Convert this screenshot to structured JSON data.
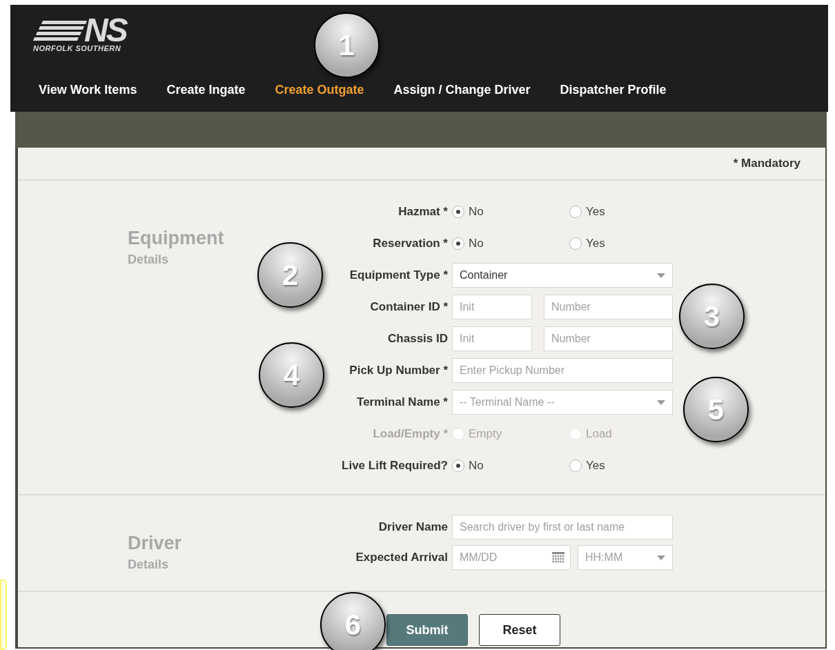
{
  "logo": {
    "mark": "NS",
    "name": "NORFOLK SOUTHERN"
  },
  "nav": [
    {
      "label": "View Work Items",
      "selected": false
    },
    {
      "label": "Create Ingate",
      "selected": false
    },
    {
      "label": "Create Outgate",
      "selected": true
    },
    {
      "label": "Assign / Change Driver",
      "selected": false
    },
    {
      "label": "Dispatcher Profile",
      "selected": false
    }
  ],
  "mandatory_note": "* Mandatory",
  "sections": [
    {
      "title": "Equipment",
      "subtitle": "Details",
      "rows": [
        {
          "kind": "radio",
          "label": "Hazmat *",
          "disabled": false,
          "options": [
            {
              "label": "No",
              "selected": true
            },
            {
              "label": "Yes",
              "selected": false
            }
          ]
        },
        {
          "kind": "radio",
          "label": "Reservation *",
          "disabled": false,
          "options": [
            {
              "label": "No",
              "selected": true
            },
            {
              "label": "Yes",
              "selected": false
            }
          ]
        },
        {
          "kind": "select",
          "label": "Equipment Type *",
          "value": "Container"
        },
        {
          "kind": "pair",
          "label": "Container ID *",
          "fields": [
            {
              "placeholder": "Init"
            },
            {
              "placeholder": "Number"
            }
          ]
        },
        {
          "kind": "pair",
          "label": "Chassis ID",
          "fields": [
            {
              "placeholder": "Init"
            },
            {
              "placeholder": "Number"
            }
          ]
        },
        {
          "kind": "text",
          "label": "Pick Up Number *",
          "placeholder": "Enter Pickup Number"
        },
        {
          "kind": "select",
          "label": "Terminal Name *",
          "placeholder": "-- Terminal Name --"
        },
        {
          "kind": "radio",
          "label": "Load/Empty *",
          "disabled": true,
          "options": [
            {
              "label": "Empty",
              "selected": false
            },
            {
              "label": "Load",
              "selected": false
            }
          ]
        },
        {
          "kind": "radio",
          "label": "Live Lift Required?",
          "disabled": false,
          "options": [
            {
              "label": "No",
              "selected": true
            },
            {
              "label": "Yes",
              "selected": false
            }
          ]
        }
      ]
    },
    {
      "title": "Driver",
      "subtitle": "Details",
      "rows": [
        {
          "kind": "text",
          "label": "Driver Name",
          "placeholder": "Search driver by first or last name"
        },
        {
          "kind": "datetime",
          "label": "Expected Arrival",
          "date_placeholder": "MM/DD",
          "time_placeholder": "HH:MM"
        }
      ]
    }
  ],
  "buttons": [
    {
      "label": "Submit",
      "kind": "primary"
    },
    {
      "label": "Reset",
      "kind": "secondary"
    }
  ],
  "callouts": [
    {
      "label": "1"
    },
    {
      "label": "2"
    },
    {
      "label": "3"
    },
    {
      "label": "4"
    },
    {
      "label": "5"
    },
    {
      "label": "6"
    }
  ]
}
